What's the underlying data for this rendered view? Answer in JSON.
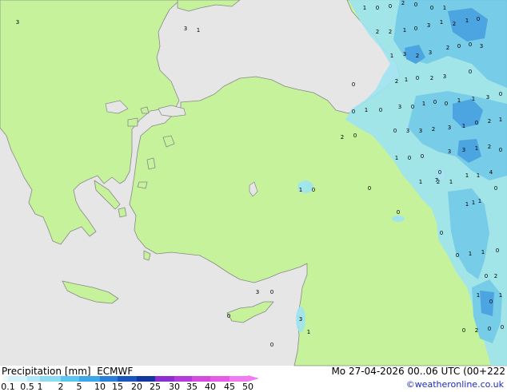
{
  "map": {
    "colors": {
      "sea": "#e6e6e6",
      "land": "#c5f29b",
      "coast": "#888888",
      "precip_light": "#9fe4f2",
      "precip_mid": "#5bbef2",
      "precip_heavy": "#3c93e6",
      "value_text": "#000000"
    },
    "cell_values": [
      "1",
      "0",
      "0",
      "2",
      "0",
      "0",
      "1",
      "3",
      "3",
      "1",
      "2",
      "2",
      "1",
      "0",
      "3",
      "1",
      "2",
      "1",
      "0",
      "1",
      "3",
      "2",
      "3",
      "2",
      "0",
      "0",
      "3",
      "2",
      "1",
      "0",
      "2",
      "3",
      "0",
      "0",
      "3",
      "0",
      "1",
      "0",
      "0",
      "1",
      "1",
      "3",
      "0",
      "0",
      "1",
      "0",
      "0",
      "3",
      "3",
      "2",
      "3",
      "1",
      "0",
      "2",
      "1",
      "2",
      "0",
      "1",
      "0",
      "0",
      "3",
      "3",
      "1",
      "2",
      "0",
      "2",
      "1",
      "1",
      "1",
      "4",
      "0",
      "0",
      "1",
      "1",
      "1",
      "7",
      "1",
      "1",
      "0",
      "0",
      "0",
      "0",
      "0",
      "1",
      "1",
      "0",
      "0",
      "2",
      "1",
      "0",
      "1",
      "2",
      "0",
      "0",
      "3",
      "0",
      "0",
      "0",
      "3",
      "1",
      "0"
    ]
  },
  "legend": {
    "title": "Precipitation [mm]  ECMWF",
    "date_label": "Mo 27-04-2026 00..06 UTC (00+222",
    "credit": "©weatheronline.co.uk",
    "ticks": [
      "0.1",
      "0.5",
      "1",
      "2",
      "5",
      "10",
      "15",
      "20",
      "25",
      "30",
      "35",
      "40",
      "45",
      "50"
    ],
    "colors": [
      "#f0f8fc",
      "#d6f2fa",
      "#b4e8f6",
      "#8edcf4",
      "#5cc6f0",
      "#3ca8e8",
      "#2a7fd8",
      "#1a55c0",
      "#1438a0",
      "#8c2fd0",
      "#b43cdc",
      "#d44cdc",
      "#e65ce6",
      "#ef7cf0"
    ]
  }
}
